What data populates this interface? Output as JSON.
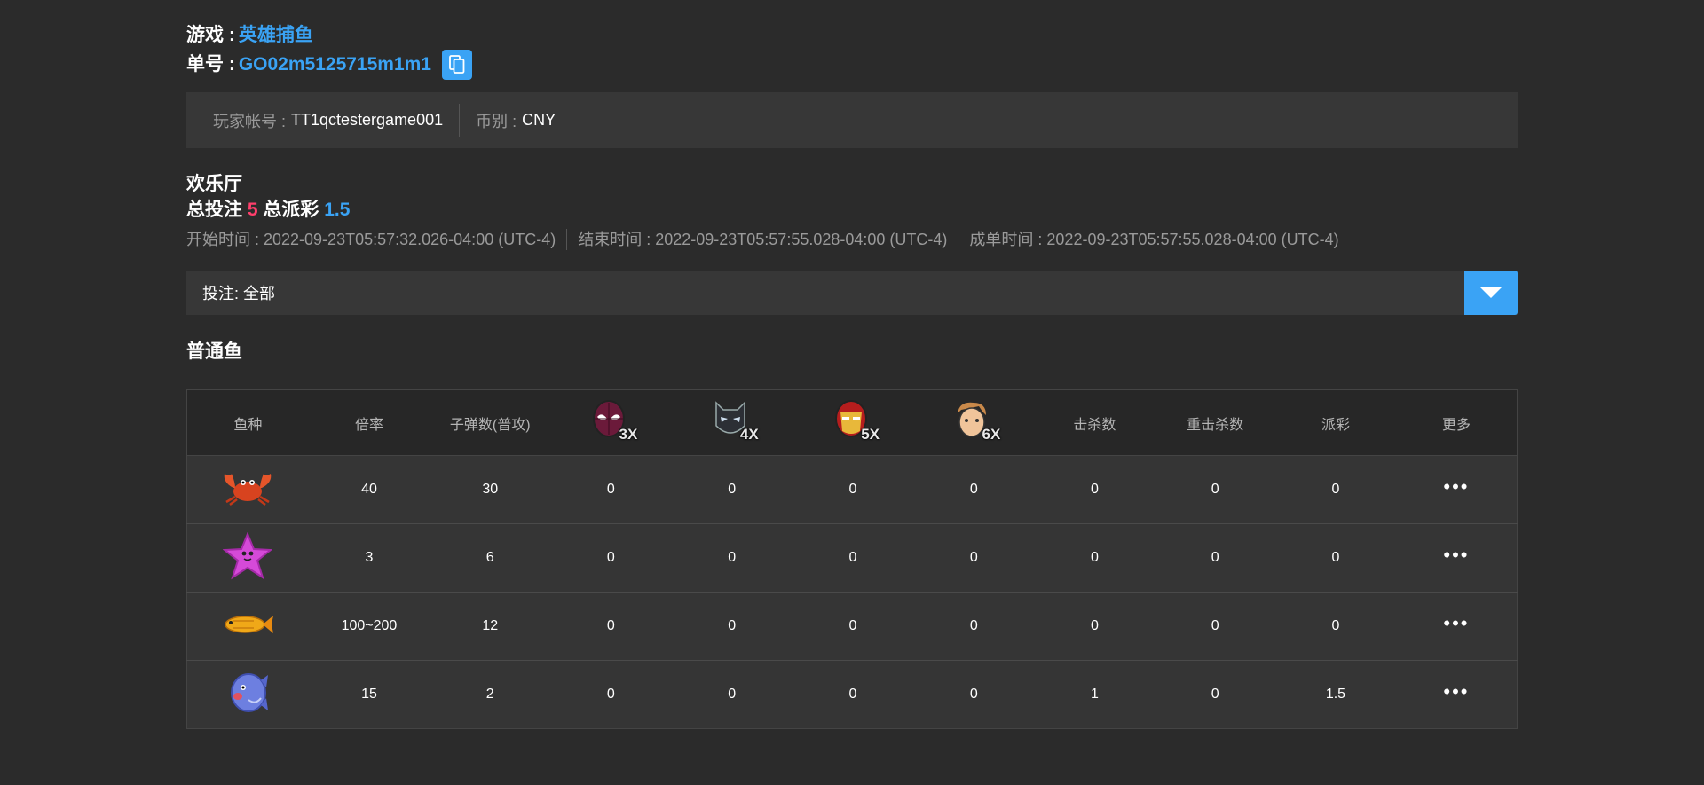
{
  "header": {
    "game_label": "游戏 :",
    "game_name": "英雄捕鱼",
    "order_label": "单号 :",
    "order_id": "GO02m5125715m1m1",
    "copy_icon": "copy-icon"
  },
  "info": {
    "player_label": "玩家帐号 :",
    "player_value": "TT1qctestergame001",
    "currency_label": "币别 :",
    "currency_value": "CNY"
  },
  "room": {
    "name": "欢乐厅",
    "total_bet_label": "总投注",
    "total_bet": "5",
    "total_payout_label": "总派彩",
    "total_payout": "1.5"
  },
  "times": {
    "start": "开始时间 : 2022-09-23T05:57:32.026-04:00 (UTC-4)",
    "end": "结束时间 : 2022-09-23T05:57:55.028-04:00 (UTC-4)",
    "settle": "成单时间 : 2022-09-23T05:57:55.028-04:00 (UTC-4)"
  },
  "filter": {
    "label": "投注: 全部",
    "dropdown_icon": "chevron-down-icon"
  },
  "section_title": "普通鱼",
  "table": {
    "headers": {
      "fish": "鱼种",
      "multiplier": "倍率",
      "bullets": "子弹数(普攻)",
      "hero1": "3X",
      "hero2": "4X",
      "hero3": "5X",
      "hero4": "6X",
      "kills": "击杀数",
      "heavy_kills": "重击杀数",
      "payout": "派彩",
      "more": "更多"
    },
    "rows": [
      {
        "fish_icon": "crab-icon",
        "multiplier": "40",
        "bullets": "30",
        "h1": "0",
        "h2": "0",
        "h3": "0",
        "h4": "0",
        "kills": "0",
        "heavy": "0",
        "payout": "0",
        "more": "•••"
      },
      {
        "fish_icon": "starfish-icon",
        "multiplier": "3",
        "bullets": "6",
        "h1": "0",
        "h2": "0",
        "h3": "0",
        "h4": "0",
        "kills": "0",
        "heavy": "0",
        "payout": "0",
        "more": "•••"
      },
      {
        "fish_icon": "golden-fish-icon",
        "multiplier": "100~200",
        "bullets": "12",
        "h1": "0",
        "h2": "0",
        "h3": "0",
        "h4": "0",
        "kills": "0",
        "heavy": "0",
        "payout": "0",
        "more": "•••"
      },
      {
        "fish_icon": "pufferfish-icon",
        "multiplier": "15",
        "bullets": "2",
        "h1": "0",
        "h2": "0",
        "h3": "0",
        "h4": "0",
        "kills": "1",
        "heavy": "0",
        "payout": "1.5",
        "more": "•••"
      }
    ]
  },
  "colors": {
    "background": "#2b2b2b",
    "accent_blue": "#3aa3f5",
    "accent_red": "#ff3f6c",
    "panel": "#373737"
  }
}
